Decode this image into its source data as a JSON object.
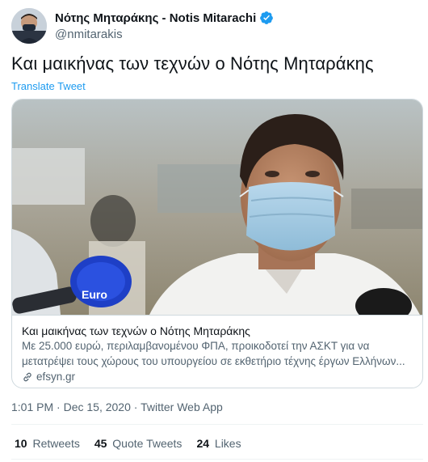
{
  "author": {
    "display_name": "Νότης Μηταράκης - Notis Mitarachi",
    "handle": "@nmitarakis",
    "verified_icon": "verified-badge-icon"
  },
  "tweet": {
    "text": "Και μαικήνας των τεχνών ο Νότης Μηταράκης",
    "translate_label": "Translate Tweet"
  },
  "card": {
    "title": "Και μαικήνας των τεχνών ο Νότης Μηταράκης",
    "description": "Με 25.000 ευρώ, περιλαμβανομένου ΦΠΑ, προικοδοτεί την ΑΣΚΤ για να μετατρέψει τους χώρους του υπουργείου σε εκθετήριο τέχνης έργων Ελλήνων...",
    "domain": "efsyn.gr",
    "domain_icon": "link-icon",
    "microphone_label": "Euro"
  },
  "meta": {
    "time": "1:01 PM",
    "separator": " · ",
    "date": "Dec 15, 2020",
    "source": "Twitter Web App"
  },
  "stats": {
    "retweets_count": "10",
    "retweets_label": "Retweets",
    "quotes_count": "45",
    "quotes_label": "Quote Tweets",
    "likes_count": "24",
    "likes_label": "Likes"
  },
  "colors": {
    "accent": "#1d9bf0",
    "text": "#0f1419",
    "secondary": "#536471",
    "border": "#cfd9de"
  }
}
